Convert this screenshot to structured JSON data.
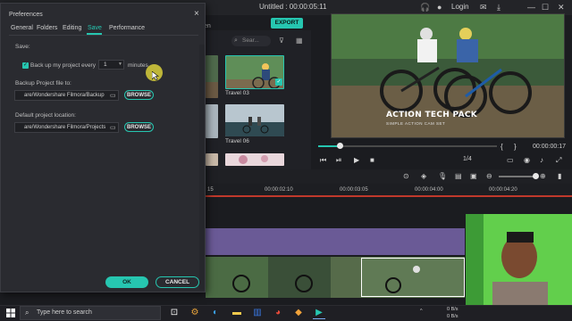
{
  "window": {
    "title": "Untitled : 00:00:05:11",
    "login": "Login",
    "export_label": "EXPORT"
  },
  "media": {
    "tab_label": "en",
    "search_placeholder": "Sear...",
    "thumbs": [
      {
        "label": "Travel 03"
      },
      {
        "label": "Travel 06"
      }
    ]
  },
  "preview": {
    "title": "ACTION TECH PACK",
    "subtitle": "SIMPLE ACTION CAM SET",
    "progress": 0.12,
    "timecode": "00:00:00:17",
    "ratio": "1/4"
  },
  "timeline": {
    "ruler_labels": [
      "15",
      "00:00:02:10",
      "00:00:03:05",
      "00:00:04:00",
      "00:00:04:20"
    ]
  },
  "dialog": {
    "title": "Preferences",
    "tabs": [
      "General",
      "Folders",
      "Editing",
      "Save",
      "Performance"
    ],
    "active_tab": "Save",
    "section_label": "Save:",
    "backup_checkbox_label": "Back up my project every",
    "backup_checked": true,
    "backup_interval": "1",
    "interval_unit": "minutes",
    "backup_file_label": "Backup Project file to:",
    "backup_path": "are/Wondershare Filmora/Backup",
    "default_location_label": "Default project location:",
    "default_path": "are/Wondershare Filmora/Projects",
    "browse_label": "BROWSE",
    "ok_label": "OK",
    "cancel_label": "CANCEL"
  },
  "taskbar": {
    "search_placeholder": "Type here to search",
    "net_up": "0 B/s",
    "net_down": "0 B/s"
  },
  "colors": {
    "accent": "#26c6b0",
    "dialog_bg": "#2a2b30",
    "purple_track": "#6a5a96"
  }
}
